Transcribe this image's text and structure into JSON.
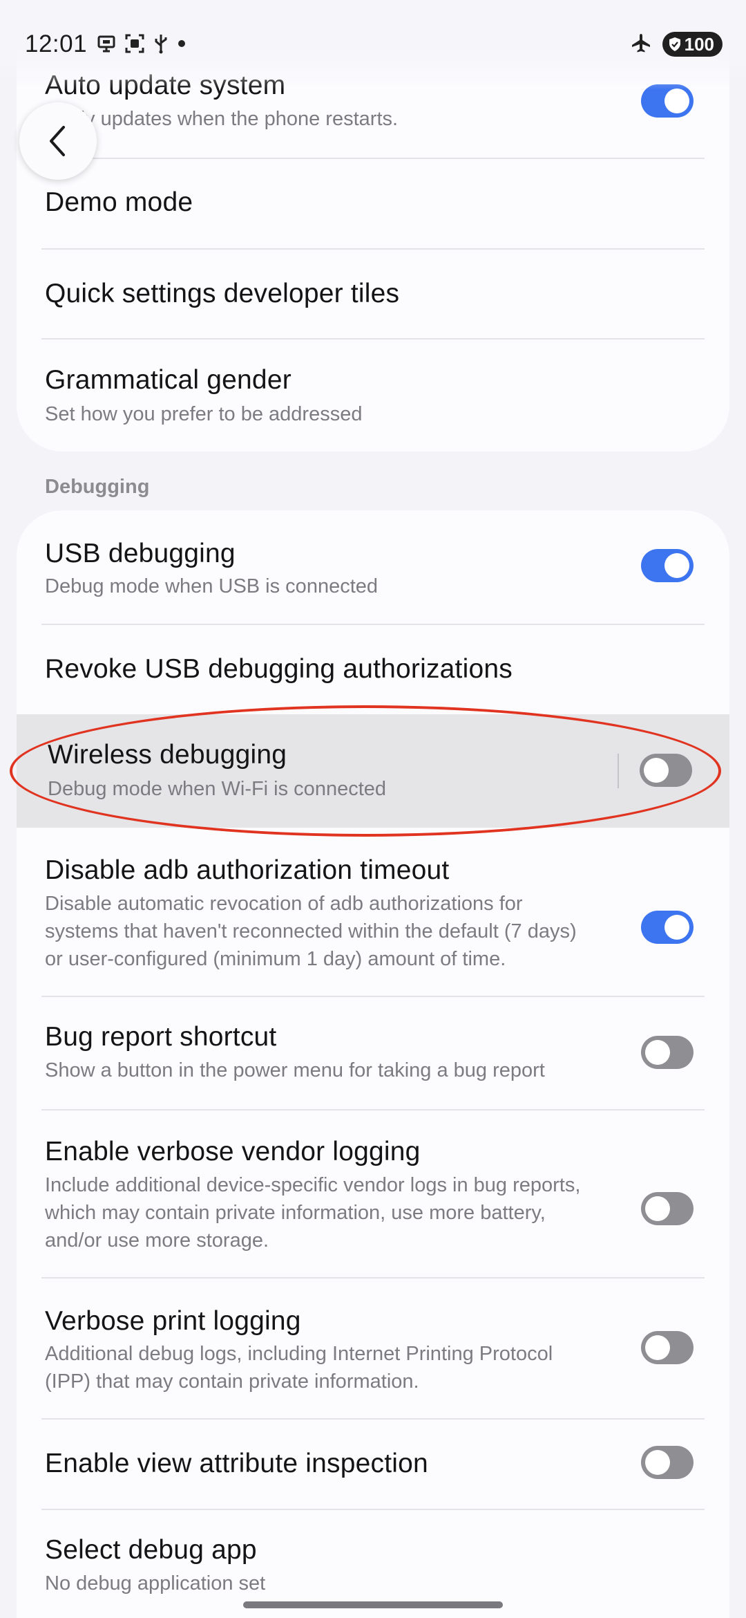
{
  "status_bar": {
    "time": "12:01",
    "icons": [
      "screen-cast-icon",
      "screenshot-icon",
      "usb-icon",
      "dot-icon"
    ],
    "right_icons": [
      "airplane-mode-icon"
    ],
    "battery": "100"
  },
  "nav": {
    "back_icon": "chevron-left-icon"
  },
  "top_card": {
    "items": [
      {
        "title": "Auto update system",
        "subtitle": "Apply updates when the phone restarts.",
        "toggle": "on"
      },
      {
        "title": "Demo mode"
      },
      {
        "title": "Quick settings developer tiles"
      },
      {
        "title": "Grammatical gender",
        "subtitle": "Set how you prefer to be addressed"
      }
    ]
  },
  "debugging": {
    "header": "Debugging",
    "items": [
      {
        "title": "USB debugging",
        "subtitle": "Debug mode when USB is connected",
        "toggle": "on"
      },
      {
        "title": "Revoke USB debugging authorizations"
      },
      {
        "title": "Wireless debugging",
        "subtitle": "Debug mode when Wi-Fi is connected",
        "toggle": "off"
      },
      {
        "title": "Disable adb authorization timeout",
        "subtitle_lines": [
          "Disable automatic revocation of adb authorizations for",
          "systems that haven't reconnected within the default (7 days)",
          "or user-configured (minimum 1 day) amount of time."
        ],
        "toggle": "on"
      },
      {
        "title": "Bug report shortcut",
        "subtitle": "Show a button in the power menu for taking a bug report",
        "toggle": "off"
      },
      {
        "title": "Enable verbose vendor logging",
        "subtitle_lines": [
          "Include additional device-specific vendor logs in bug reports,",
          "which may contain private information, use more battery,",
          "and/or use more storage."
        ],
        "toggle": "off"
      },
      {
        "title": "Verbose print logging",
        "subtitle_lines": [
          "Additional debug logs, including Internet Printing Protocol",
          "(IPP) that may contain private information."
        ],
        "toggle": "off"
      },
      {
        "title": "Enable view attribute inspection",
        "toggle": "off"
      },
      {
        "title": "Select debug app",
        "subtitle": "No debug application set"
      }
    ]
  },
  "colors": {
    "accent": "#3d74f0",
    "annotation": "#e03320",
    "highlight": "#e5e5e8"
  }
}
